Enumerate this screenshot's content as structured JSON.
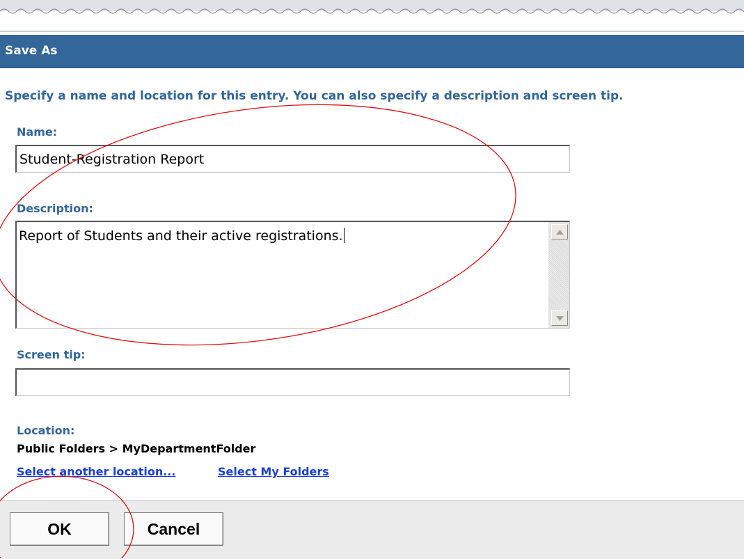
{
  "dialog": {
    "title": "Save As",
    "instruction": "Specify a name and location for this entry. You can also specify a description and screen tip."
  },
  "form": {
    "name_label": "Name:",
    "name_value": "Student-Registration Report",
    "description_label": "Description:",
    "description_value": "Report of Students and their active registrations.",
    "screen_tip_label": "Screen tip:",
    "screen_tip_value": ""
  },
  "location": {
    "label": "Location:",
    "value": "Public Folders > MyDepartmentFolder",
    "select_another_label": "Select another location...",
    "select_my_folders_label": "Select My Folders"
  },
  "buttons": {
    "ok_label": "OK",
    "cancel_label": "Cancel"
  },
  "colors": {
    "title_bar": "#336699",
    "label_text": "#336699",
    "link": "#1a3fd6",
    "annotation": "#e01010"
  }
}
